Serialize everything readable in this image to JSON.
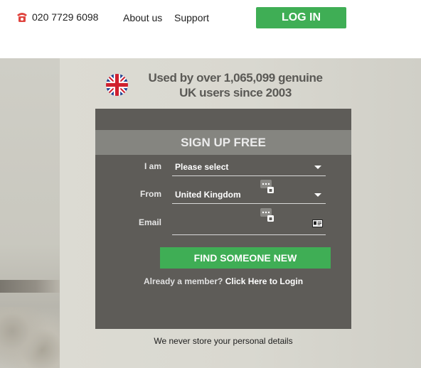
{
  "header": {
    "phone_icon": "telephone-icon",
    "phone": "020 7729 6098",
    "nav": {
      "about": "About us",
      "support": "Support"
    },
    "login_label": "LOG IN"
  },
  "hero": {
    "flag_icon": "uk-flag-icon",
    "tagline": "Used by over 1,065,099 genuine UK users since 2003"
  },
  "signup": {
    "title": "SIGN UP FREE",
    "iam_label": "I am",
    "iam_value": "Please select",
    "from_label": "From",
    "from_value": "United Kingdom",
    "email_label": "Email",
    "email_value": "",
    "submit_label": "FIND SOMEONE NEW",
    "member_prefix": "Already a member?",
    "member_link": "Click Here to Login"
  },
  "footer_note": "We never store your personal details",
  "colors": {
    "accent_green": "#3fae55",
    "panel_bg": "#5e5c58",
    "panel_header_bg": "#858580",
    "phone_icon": "#e0453f"
  }
}
